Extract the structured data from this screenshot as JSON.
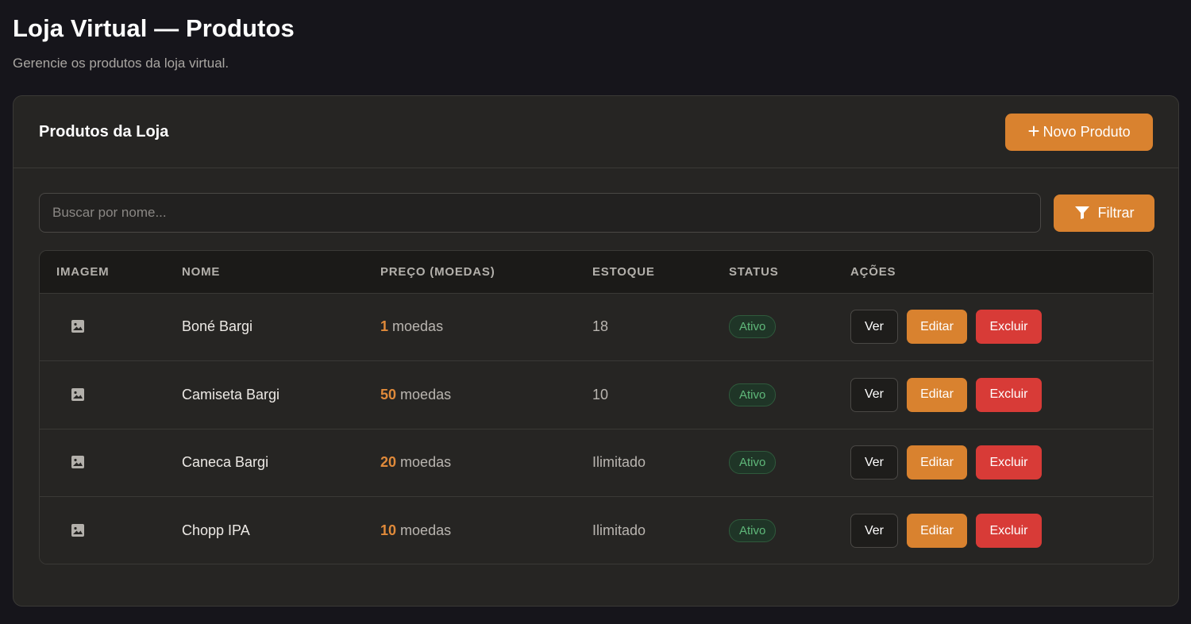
{
  "page": {
    "title": "Loja Virtual — Produtos",
    "subtitle": "Gerencie os produtos da loja virtual."
  },
  "card": {
    "title": "Produtos da Loja",
    "new_button_label": "Novo Produto"
  },
  "search": {
    "placeholder": "Buscar por nome...",
    "value": "",
    "filter_label": "Filtrar"
  },
  "table": {
    "headers": [
      "IMAGEM",
      "NOME",
      "PREÇO (MOEDAS)",
      "ESTOQUE",
      "STATUS",
      "AÇÕES"
    ],
    "rows": [
      {
        "name": "Boné Bargi",
        "price": "1",
        "unit": "moedas",
        "stock": "18",
        "status": "Ativo"
      },
      {
        "name": "Camiseta Bargi",
        "price": "50",
        "unit": "moedas",
        "stock": "10",
        "status": "Ativo"
      },
      {
        "name": "Caneca Bargi",
        "price": "20",
        "unit": "moedas",
        "stock": "Ilimitado",
        "status": "Ativo"
      },
      {
        "name": "Chopp IPA",
        "price": "10",
        "unit": "moedas",
        "stock": "Ilimitado",
        "status": "Ativo"
      }
    ],
    "actions": {
      "view": "Ver",
      "edit": "Editar",
      "delete": "Excluir"
    }
  },
  "icons": {
    "new": "plus-icon",
    "filter": "funnel-icon",
    "image": "image-placeholder-icon"
  },
  "colors": {
    "accent": "#d9822f",
    "danger": "#d83b37",
    "success": "#5fb87a",
    "background": "#16151b",
    "card": "#262523"
  }
}
